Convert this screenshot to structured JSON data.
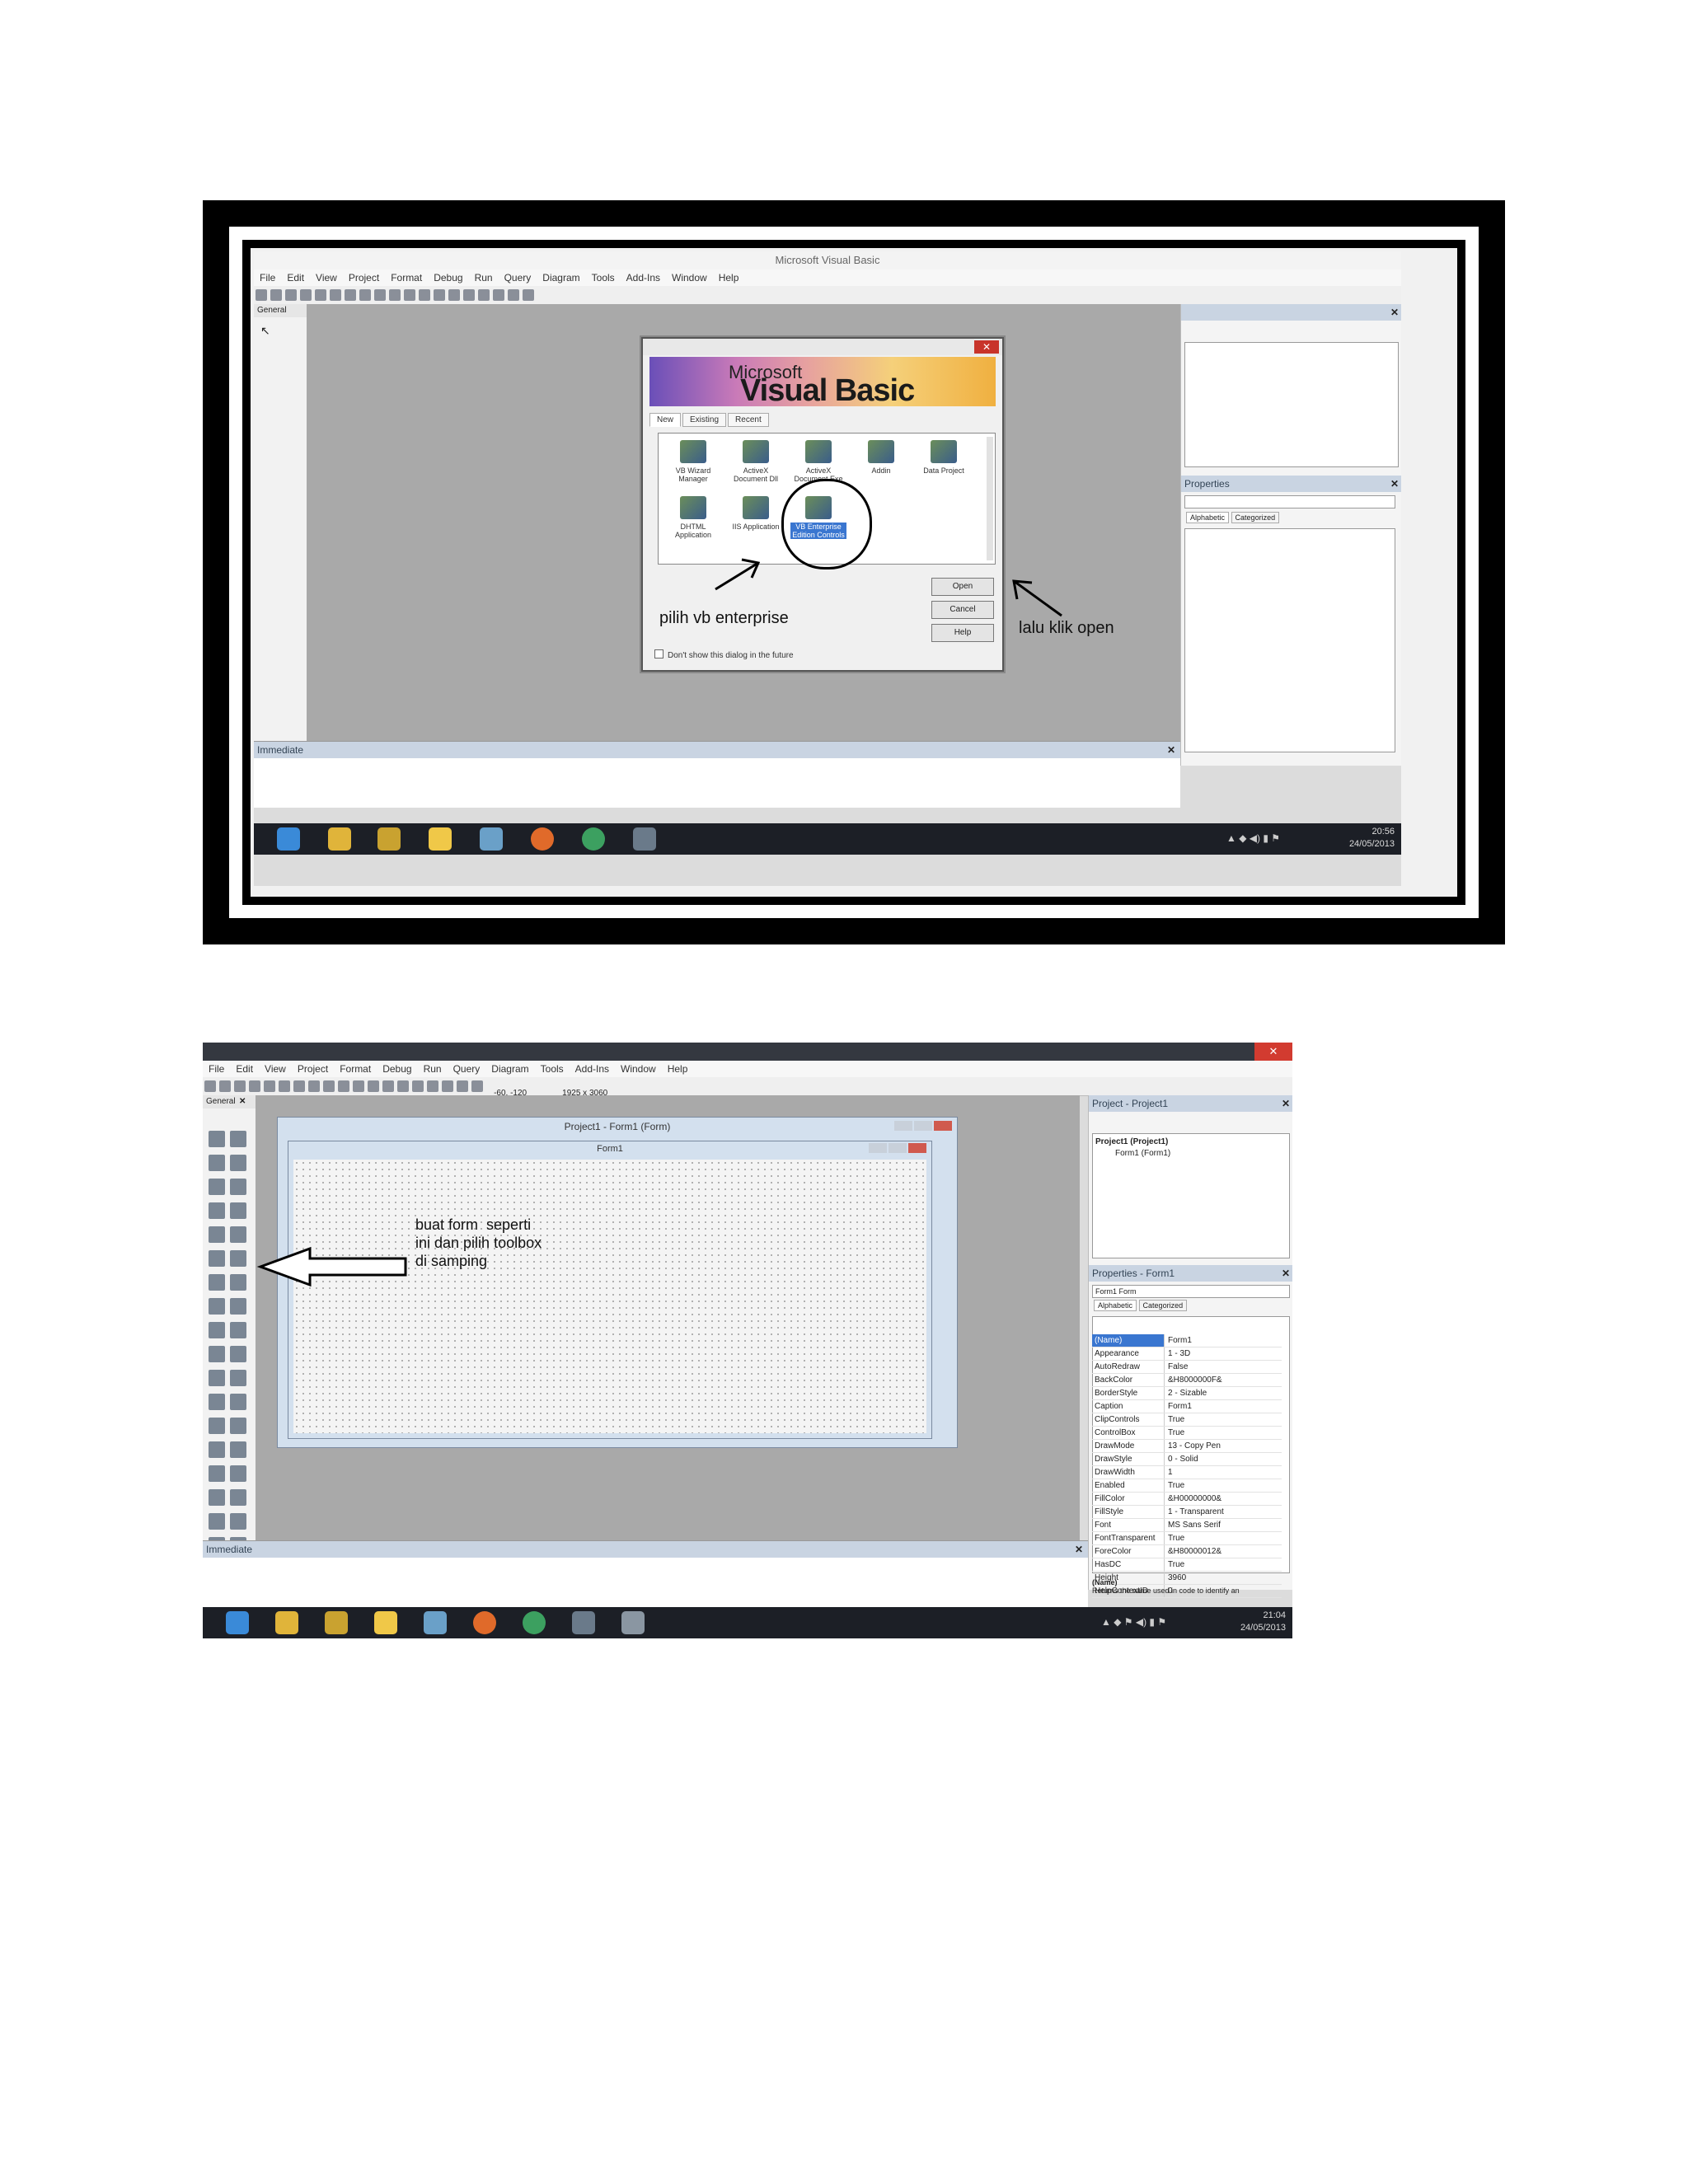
{
  "screenshot1": {
    "window_title": "Microsoft Visual Basic",
    "menu": [
      "File",
      "Edit",
      "View",
      "Project",
      "Format",
      "Debug",
      "Run",
      "Query",
      "Diagram",
      "Tools",
      "Add-Ins",
      "Window",
      "Help"
    ],
    "toolbox_header": "General",
    "panels": {
      "properties": "Properties",
      "prop_tabs": [
        "Alphabetic",
        "Categorized"
      ]
    },
    "immediate": "Immediate",
    "dialog": {
      "banner_small": "Microsoft",
      "banner_big": "Visual Basic",
      "tabs": [
        "New",
        "Existing",
        "Recent"
      ],
      "icons": [
        {
          "label": "VB Wizard Manager"
        },
        {
          "label": "ActiveX Document Dll"
        },
        {
          "label": "ActiveX Document Exe"
        },
        {
          "label": "Addin"
        },
        {
          "label": "Data Project"
        },
        {
          "label": "DHTML Application"
        },
        {
          "label": "IIS Application"
        },
        {
          "label": "VB Enterprise Edition Controls"
        }
      ],
      "buttons": [
        "Open",
        "Cancel",
        "Help"
      ],
      "checkbox": "Don't show this dialog in the future"
    },
    "annotations": {
      "select": "pilih vb enterprise",
      "open": "lalu klik open"
    },
    "clock": {
      "time": "20:56",
      "date": "24/05/2013"
    }
  },
  "screenshot2": {
    "menu": [
      "File",
      "Edit",
      "View",
      "Project",
      "Format",
      "Debug",
      "Run",
      "Query",
      "Diagram",
      "Tools",
      "Add-Ins",
      "Window",
      "Help"
    ],
    "toolbar_coords": "-60, -120",
    "toolbar_size": "1925 x 3060",
    "toolbox_header": "General",
    "designer_title": "Project1 - Form1 (Form)",
    "form_title": "Form1",
    "annotation": "buat form  seperti\nini dan pilih toolbox\ndi samping",
    "project_panel": {
      "title": "Project - Project1",
      "tree": [
        "Project1 (Project1)",
        "Form1 (Form1)"
      ]
    },
    "properties_panel": {
      "title": "Properties - Form1",
      "object": "Form1 Form",
      "tabs": [
        "Alphabetic",
        "Categorized"
      ],
      "rows": [
        {
          "k": "(Name)",
          "v": "Form1"
        },
        {
          "k": "Appearance",
          "v": "1 - 3D"
        },
        {
          "k": "AutoRedraw",
          "v": "False"
        },
        {
          "k": "BackColor",
          "v": "&H8000000F&"
        },
        {
          "k": "BorderStyle",
          "v": "2 - Sizable"
        },
        {
          "k": "Caption",
          "v": "Form1"
        },
        {
          "k": "ClipControls",
          "v": "True"
        },
        {
          "k": "ControlBox",
          "v": "True"
        },
        {
          "k": "DrawMode",
          "v": "13 - Copy Pen"
        },
        {
          "k": "DrawStyle",
          "v": "0 - Solid"
        },
        {
          "k": "DrawWidth",
          "v": "1"
        },
        {
          "k": "Enabled",
          "v": "True"
        },
        {
          "k": "FillColor",
          "v": "&H00000000&"
        },
        {
          "k": "FillStyle",
          "v": "1 - Transparent"
        },
        {
          "k": "Font",
          "v": "MS Sans Serif"
        },
        {
          "k": "FontTransparent",
          "v": "True"
        },
        {
          "k": "ForeColor",
          "v": "&H80000012&"
        },
        {
          "k": "HasDC",
          "v": "True"
        },
        {
          "k": "Height",
          "v": "3960"
        },
        {
          "k": "HelpContextID",
          "v": "0"
        }
      ],
      "desc_title": "(Name)",
      "desc_text": "Returns the name used in code to identify an"
    },
    "immediate": "Immediate",
    "clock": {
      "time": "21:04",
      "date": "24/05/2013"
    }
  }
}
